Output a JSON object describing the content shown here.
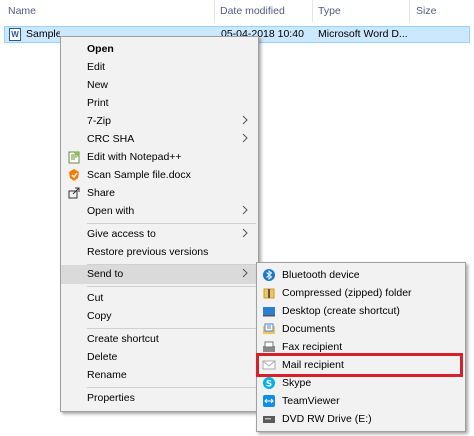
{
  "columns": {
    "name": "Name",
    "date": "Date modified",
    "type": "Type",
    "size": "Size"
  },
  "file": {
    "name": "Sample file",
    "date": "05-04-2018 10:40",
    "type": "Microsoft Word D..."
  },
  "menu": {
    "open": "Open",
    "edit": "Edit",
    "new": "New",
    "print": "Print",
    "zip": "7-Zip",
    "crc": "CRC SHA",
    "notepad": "Edit with Notepad++",
    "scan": "Scan Sample file.docx",
    "share": "Share",
    "open_with": "Open with",
    "give_access": "Give access to",
    "restore": "Restore previous versions",
    "send_to": "Send to",
    "cut": "Cut",
    "copy": "Copy",
    "create_shortcut": "Create shortcut",
    "delete": "Delete",
    "rename": "Rename",
    "properties": "Properties"
  },
  "send_to": {
    "bluetooth": "Bluetooth device",
    "compressed": "Compressed (zipped) folder",
    "desktop": "Desktop (create shortcut)",
    "documents": "Documents",
    "fax": "Fax recipient",
    "mail": "Mail recipient",
    "skype": "Skype",
    "teamviewer": "TeamViewer",
    "dvd": "DVD RW Drive (E:)"
  },
  "colors": {
    "selection": "#cce8ff",
    "highlight": "#dadada",
    "annotation": "#d6202a"
  }
}
